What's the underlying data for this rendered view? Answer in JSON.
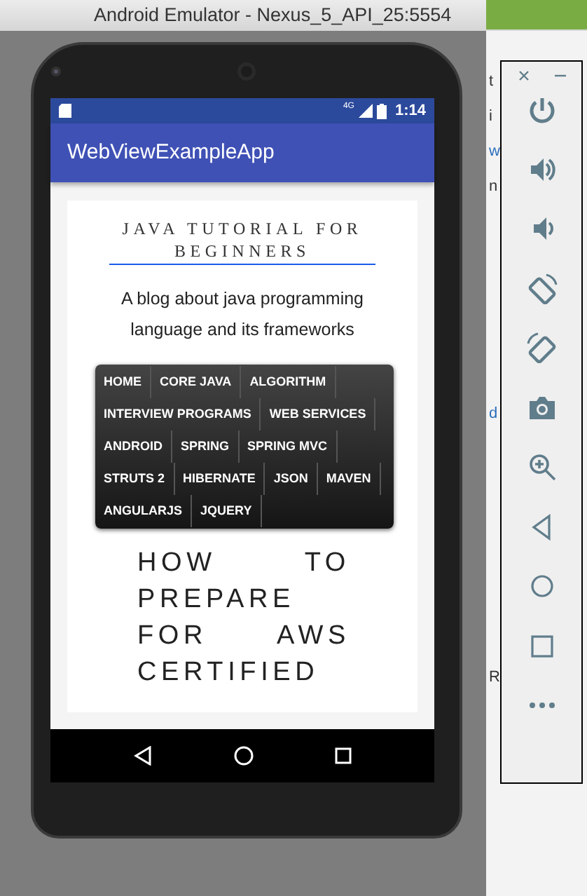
{
  "window": {
    "title": "Android Emulator - Nexus_5_API_25:5554"
  },
  "status_bar": {
    "network": "4G",
    "time": "1:14"
  },
  "app_bar": {
    "title": "WebViewExampleApp"
  },
  "page": {
    "site_title": "JAVA TUTORIAL FOR BEGINNERS",
    "tagline": "A blog about java programming language and its frameworks",
    "menu_rows": [
      [
        "HOME",
        "CORE JAVA",
        "ALGORITHM"
      ],
      [
        "INTERVIEW PROGRAMS",
        "WEB SERVICES"
      ],
      [
        "ANDROID",
        "SPRING",
        "SPRING MVC"
      ],
      [
        "STRUTS 2",
        "HIBERNATE",
        "JSON",
        "MAVEN"
      ],
      [
        "ANGULARJS",
        "JQUERY"
      ]
    ],
    "post_title": "HOW TO PREPARE FOR AWS CERTIFIED"
  },
  "background_window": {
    "fragments": [
      "t",
      "i",
      "w",
      "n",
      "d",
      "R"
    ]
  }
}
